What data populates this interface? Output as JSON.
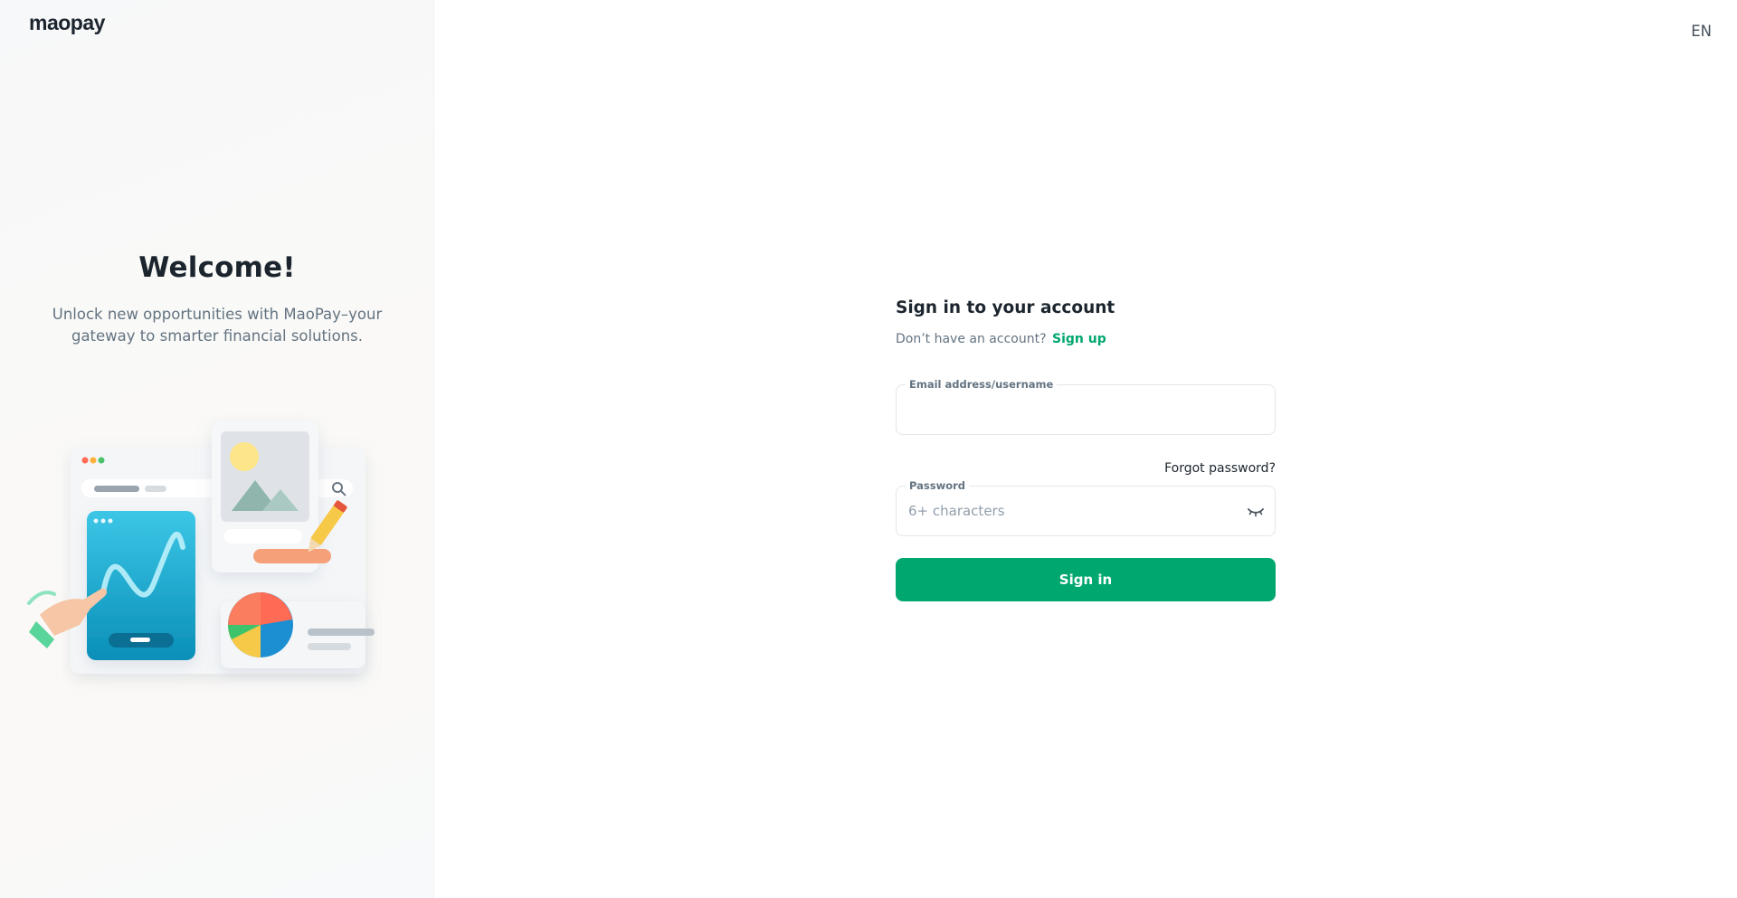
{
  "brand": {
    "logo_text": "maopay",
    "accent": "#00a76f"
  },
  "language": {
    "current": "EN"
  },
  "hero": {
    "title": "Welcome!",
    "subtitle": "Unlock new opportunities with MaoPay–your gateway to smarter financial solutions."
  },
  "form": {
    "title": "Sign in to your account",
    "no_account_text": "Don’t have an account?",
    "signup_label": "Sign up",
    "email": {
      "label": "Email address/username",
      "value": "",
      "placeholder": ""
    },
    "forgot_label": "Forgot password?",
    "password": {
      "label": "Password",
      "value": "",
      "placeholder": "6+ characters",
      "toggle_icon": "eye-closed-icon"
    },
    "submit_label": "Sign in"
  }
}
